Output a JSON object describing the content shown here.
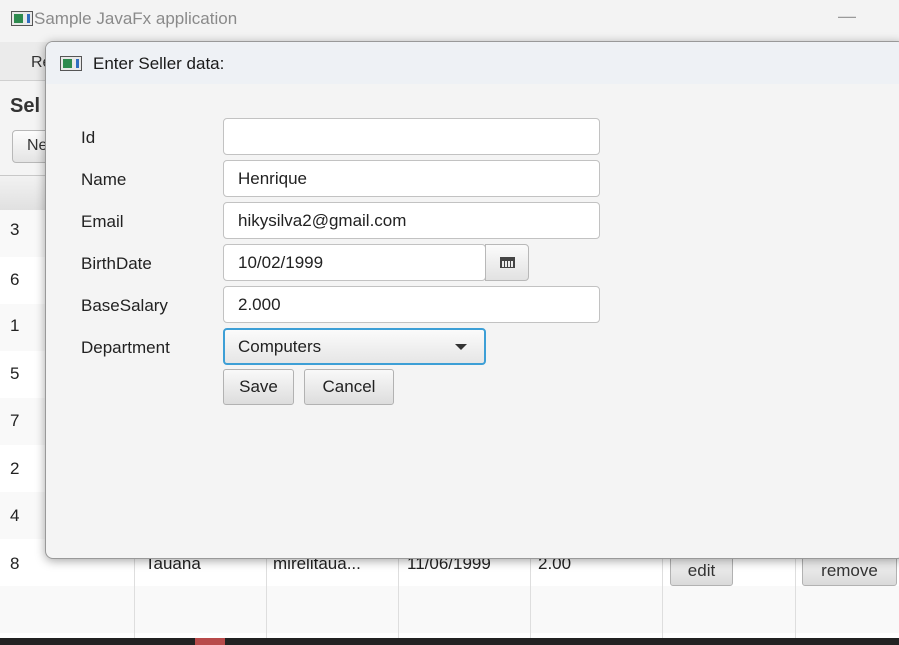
{
  "main_window": {
    "title": "Sample JavaFx application",
    "minimize_glyph": "—",
    "menu_label": "Re",
    "heading": "Sel",
    "new_button": "Ne"
  },
  "table": {
    "rows": [
      {
        "id": "3"
      },
      {
        "id": "6"
      },
      {
        "id": "1"
      },
      {
        "id": "5"
      },
      {
        "id": "7"
      },
      {
        "id": "2"
      },
      {
        "id": "4"
      },
      {
        "id": "8",
        "name": "Tauana",
        "email": "mirelitaua...",
        "birth": "11/06/1999",
        "salary": "2.00",
        "edit": "edit",
        "remove": "remove"
      }
    ]
  },
  "dialog": {
    "title": "Enter Seller data:",
    "labels": {
      "id": "Id",
      "name": "Name",
      "email": "Email",
      "birthdate": "BirthDate",
      "basesalary": "BaseSalary",
      "department": "Department"
    },
    "values": {
      "id": "",
      "name": "Henrique",
      "email": "hikysilva2@gmail.com",
      "birthdate": "10/02/1999",
      "basesalary": "2.000",
      "department": "Computers"
    },
    "save_label": "Save",
    "cancel_label": "Cancel"
  },
  "icons": {
    "app": "app-window-icon",
    "calendar": "calendar-icon",
    "dropdown": "chevron-down-icon"
  },
  "colors": {
    "focus_border": "#3d9fd6",
    "dialog_title_bg": "#eef1f5"
  }
}
